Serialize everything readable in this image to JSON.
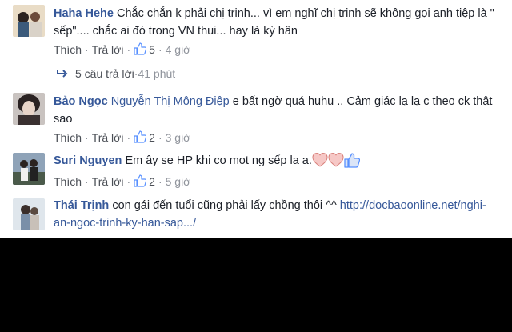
{
  "colors": {
    "link": "#365899",
    "text": "#1d2129",
    "meta": "#90949c",
    "like": "#5890ff"
  },
  "comments": [
    {
      "author": "Haha Hehe",
      "text": "Chắc chắn k phải chị trinh... vì em nghĩ chị trinh sẽ không gọi anh tiệp là \" sếp\".... chắc ai đó trong VN thui... hay là kỳ hân",
      "like": "Thích",
      "reply": "Trả lời",
      "likes": "5",
      "time": "4 giờ",
      "replies_label": "5 câu trả lời",
      "replies_time": "41 phút"
    },
    {
      "author": "Bảo Ngọc",
      "mention": "Nguyễn Thị Mông Điệp",
      "text": "e bất ngờ quá huhu .. Cảm giác lạ lạ c theo ck thật sao",
      "like": "Thích",
      "reply": "Trả lời",
      "likes": "2",
      "time": "3 giờ"
    },
    {
      "author": "Suri Nguyen",
      "text": "Em ây se HP khi co mot ng sếp la a.",
      "emojis": [
        "heart-icon",
        "heart-icon",
        "thumbs-up-icon"
      ],
      "like": "Thích",
      "reply": "Trả lời",
      "likes": "2",
      "time": "5 giờ"
    },
    {
      "author": "Thái Trịnh",
      "text": "con gái đến tuổi cũng phải lấy chồng thôi ^^",
      "link": "http://docbaoonline.net/nghi-an-ngoc-trinh-ky-han-sap.../"
    }
  ]
}
